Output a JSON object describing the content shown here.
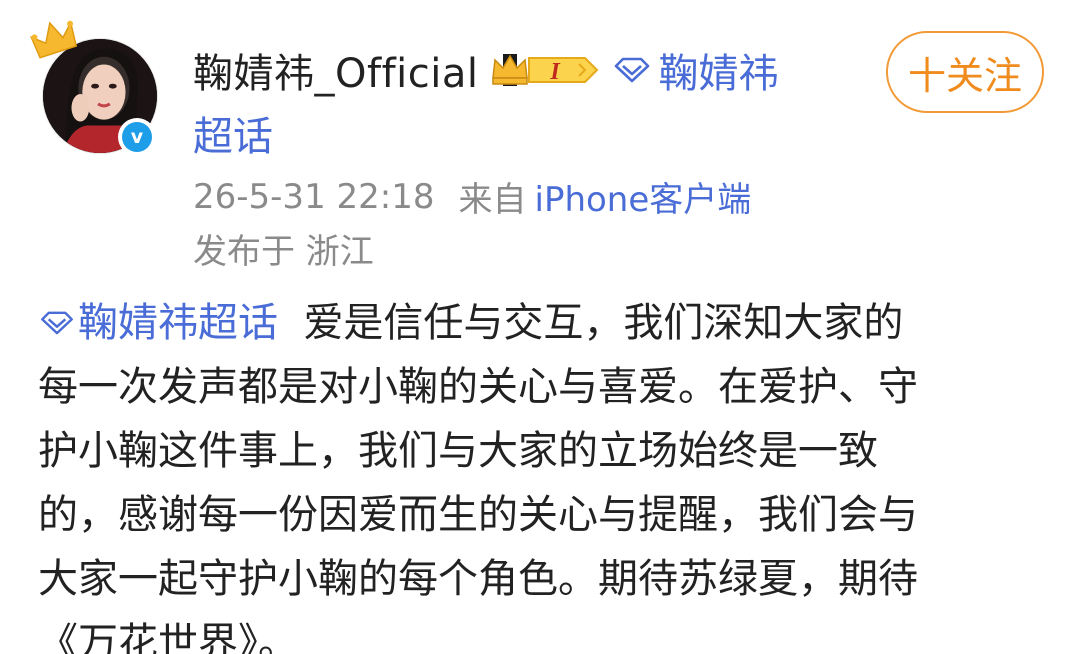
{
  "post": {
    "author": {
      "username": "鞠婧祎_Official",
      "vip_badge_text": "I",
      "verified": true,
      "avatar_icon": "user-avatar",
      "verified_icon": "verified-v-icon",
      "crown_icon": "crown-icon"
    },
    "supertopic": {
      "label_line1": "鞠婧祎",
      "label_line2": "超话",
      "icon": "diamond-icon"
    },
    "follow_button_label": "十关注",
    "timestamp": "26-5-31 22:18",
    "from_label": "来自",
    "source": "iPhone客户端",
    "location": "发布于 浙江",
    "body": {
      "topic_tag": "鞠婧祎超话",
      "line1": "爱是信任与交互，我们深知大家的",
      "line2": "每一次发声都是对小鞠的关心与喜爱。在爱护、守",
      "line3": "护小鞠这件事上，我们与大家的立场始终是一致",
      "line4": "的，感谢每一份因爱而生的关心与提醒，我们会与",
      "line5": "大家一起守护小鞠的每个角色。期待苏绿夏，期待",
      "line6": "《万花世界》。"
    },
    "colors": {
      "link_blue": "#4a6cd6",
      "follow_orange": "#f08b1d",
      "meta_gray": "#8a8a8a",
      "verified_blue": "#1e9de8",
      "crown_gold": "#f5b82e"
    }
  }
}
